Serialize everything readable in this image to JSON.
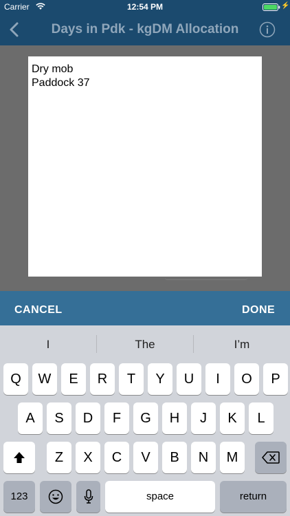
{
  "status_bar": {
    "carrier": "Carrier",
    "time": "12:54 PM",
    "wifi_icon": "wifi-icon",
    "battery_icon": "battery-icon",
    "charging_icon": "charging-bolt-icon",
    "battery_color": "#4cd964"
  },
  "nav": {
    "title": "Days in Pdk - kgDM Allocation",
    "back_icon": "chevron-left-icon",
    "info_icon": "info-circle-icon",
    "background": "#1b4a6e"
  },
  "note": {
    "line1": "Dry mob",
    "line2": "Paddock 37"
  },
  "toolbar": {
    "cancel_label": "CANCEL",
    "done_label": "DONE",
    "background": "#356f97"
  },
  "keyboard": {
    "suggestions": [
      "I",
      "The",
      "I’m"
    ],
    "row1": [
      "Q",
      "W",
      "E",
      "R",
      "T",
      "Y",
      "U",
      "I",
      "O",
      "P"
    ],
    "row2": [
      "A",
      "S",
      "D",
      "F",
      "G",
      "H",
      "J",
      "K",
      "L"
    ],
    "row3": [
      "Z",
      "X",
      "C",
      "V",
      "B",
      "N",
      "M"
    ],
    "numbers_label": "123",
    "space_label": "space",
    "return_label": "return",
    "shift_icon": "shift-arrow-icon",
    "delete_icon": "backspace-icon",
    "emoji_icon": "emoji-icon",
    "mic_icon": "microphone-icon"
  }
}
